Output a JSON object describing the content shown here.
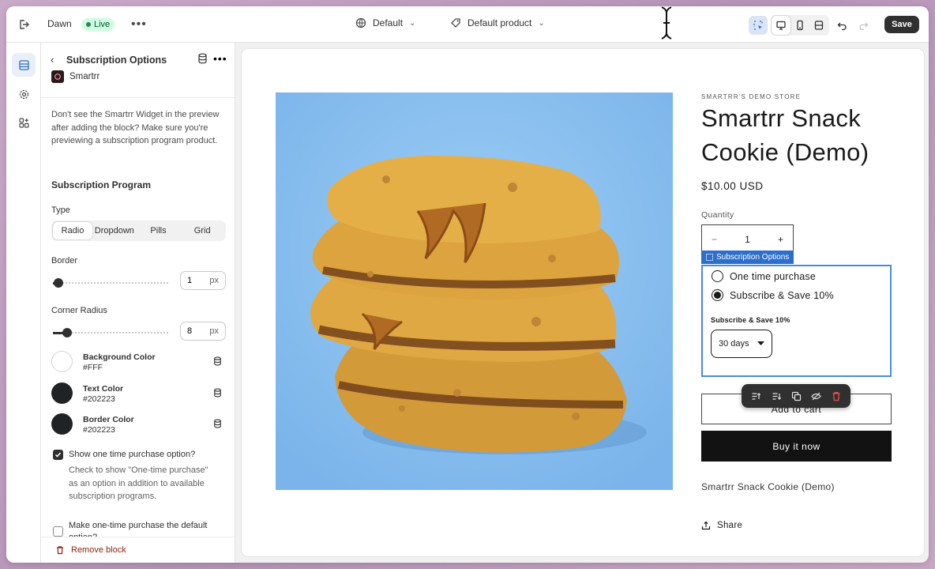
{
  "topbar": {
    "theme_name": "Dawn",
    "status_badge": "Live",
    "template_select": "Default",
    "product_select": "Default product",
    "save_label": "Save"
  },
  "sidebar": {
    "title": "Subscription Options",
    "app_name": "Smartrr",
    "help_text": "Don't see the Smartrr Widget in the preview after adding the block? Make sure you're previewing a subscription program product.",
    "section_title": "Subscription Program",
    "type": {
      "label": "Type",
      "options": [
        "Radio",
        "Dropdown",
        "Pills",
        "Grid"
      ],
      "selected": "Radio"
    },
    "border": {
      "label": "Border",
      "value": "1",
      "unit": "px",
      "level": 0.05
    },
    "corner_radius": {
      "label": "Corner Radius",
      "value": "8",
      "unit": "px",
      "level": 0.12
    },
    "colors": [
      {
        "name": "Background Color",
        "value": "#FFF",
        "swatch": "#ffffff"
      },
      {
        "name": "Text Color",
        "value": "#202223",
        "swatch": "#202223"
      },
      {
        "name": "Border Color",
        "value": "#202223",
        "swatch": "#202223"
      }
    ],
    "show_one_time": {
      "label": "Show one time purchase option?",
      "help": "Check to show \"One-time purchase\" as an option in addition to available subscription programs.",
      "checked": true
    },
    "default_one_time": {
      "label": "Make one-time purchase the default option?",
      "checked": false
    },
    "remove_label": "Remove block"
  },
  "preview": {
    "store_name": "SMARTRR'S DEMO STORE",
    "product_title": "Smartrr Snack Cookie (Demo)",
    "price": "$10.00 USD",
    "quantity_label": "Quantity",
    "quantity_value": "1",
    "quantity_minus": "−",
    "quantity_plus": "+",
    "block_tag": "Subscription Options",
    "options": [
      {
        "label": "One time purchase",
        "selected": false
      },
      {
        "label": "Subscribe & Save 10%",
        "selected": true
      }
    ],
    "frequency_label": "Subscribe & Save 10%",
    "frequency_value": "30 days",
    "add_to_cart": "Add to cart",
    "buy_now": "Buy it now",
    "description": "Smartrr Snack Cookie (Demo)",
    "share": "Share"
  },
  "icons": {
    "exit": "exit-icon",
    "globe": "globe-icon",
    "tag": "tag-icon",
    "inspector": "inspector-icon",
    "desktop": "desktop-icon",
    "mobile": "mobile-icon",
    "fullwidth": "fullwidth-icon",
    "undo": "undo-icon",
    "redo": "redo-icon",
    "sections": "sections-icon",
    "settings": "gear-icon",
    "apps": "apps-icon",
    "database": "database-icon",
    "trash": "trash-icon",
    "share": "share-icon"
  },
  "colors": {
    "accent": "#2c6ecb",
    "live_bg": "#cdfee1",
    "remove": "#8e1f0b",
    "image_bg": "#8fc2ef"
  }
}
